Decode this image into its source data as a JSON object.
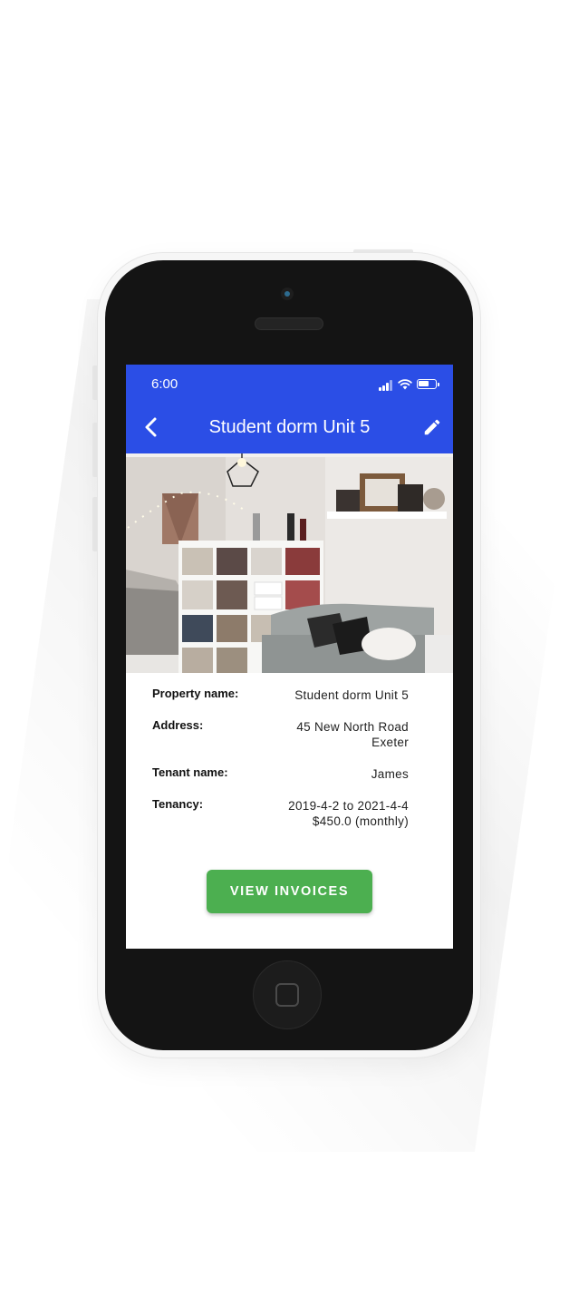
{
  "status_bar": {
    "time": "6:00"
  },
  "app_bar": {
    "title": "Student dorm Unit 5",
    "back_icon": "chevron-left-icon",
    "edit_icon": "pencil-icon"
  },
  "details": [
    {
      "label": "Property name:",
      "value": "Student dorm Unit 5"
    },
    {
      "label": "Address:",
      "value": "45 New North Road\nExeter"
    },
    {
      "label": "Tenant name:",
      "value": "James"
    },
    {
      "label": "Tenancy:",
      "value": "2019-4-2 to 2021-4-4\n$450.0 (monthly)"
    }
  ],
  "action": {
    "view_invoices_label": "VIEW INVOICES"
  },
  "colors": {
    "app_bar": "#2b4ee6",
    "button": "#4caf50",
    "phone_bezel": "#141414"
  }
}
